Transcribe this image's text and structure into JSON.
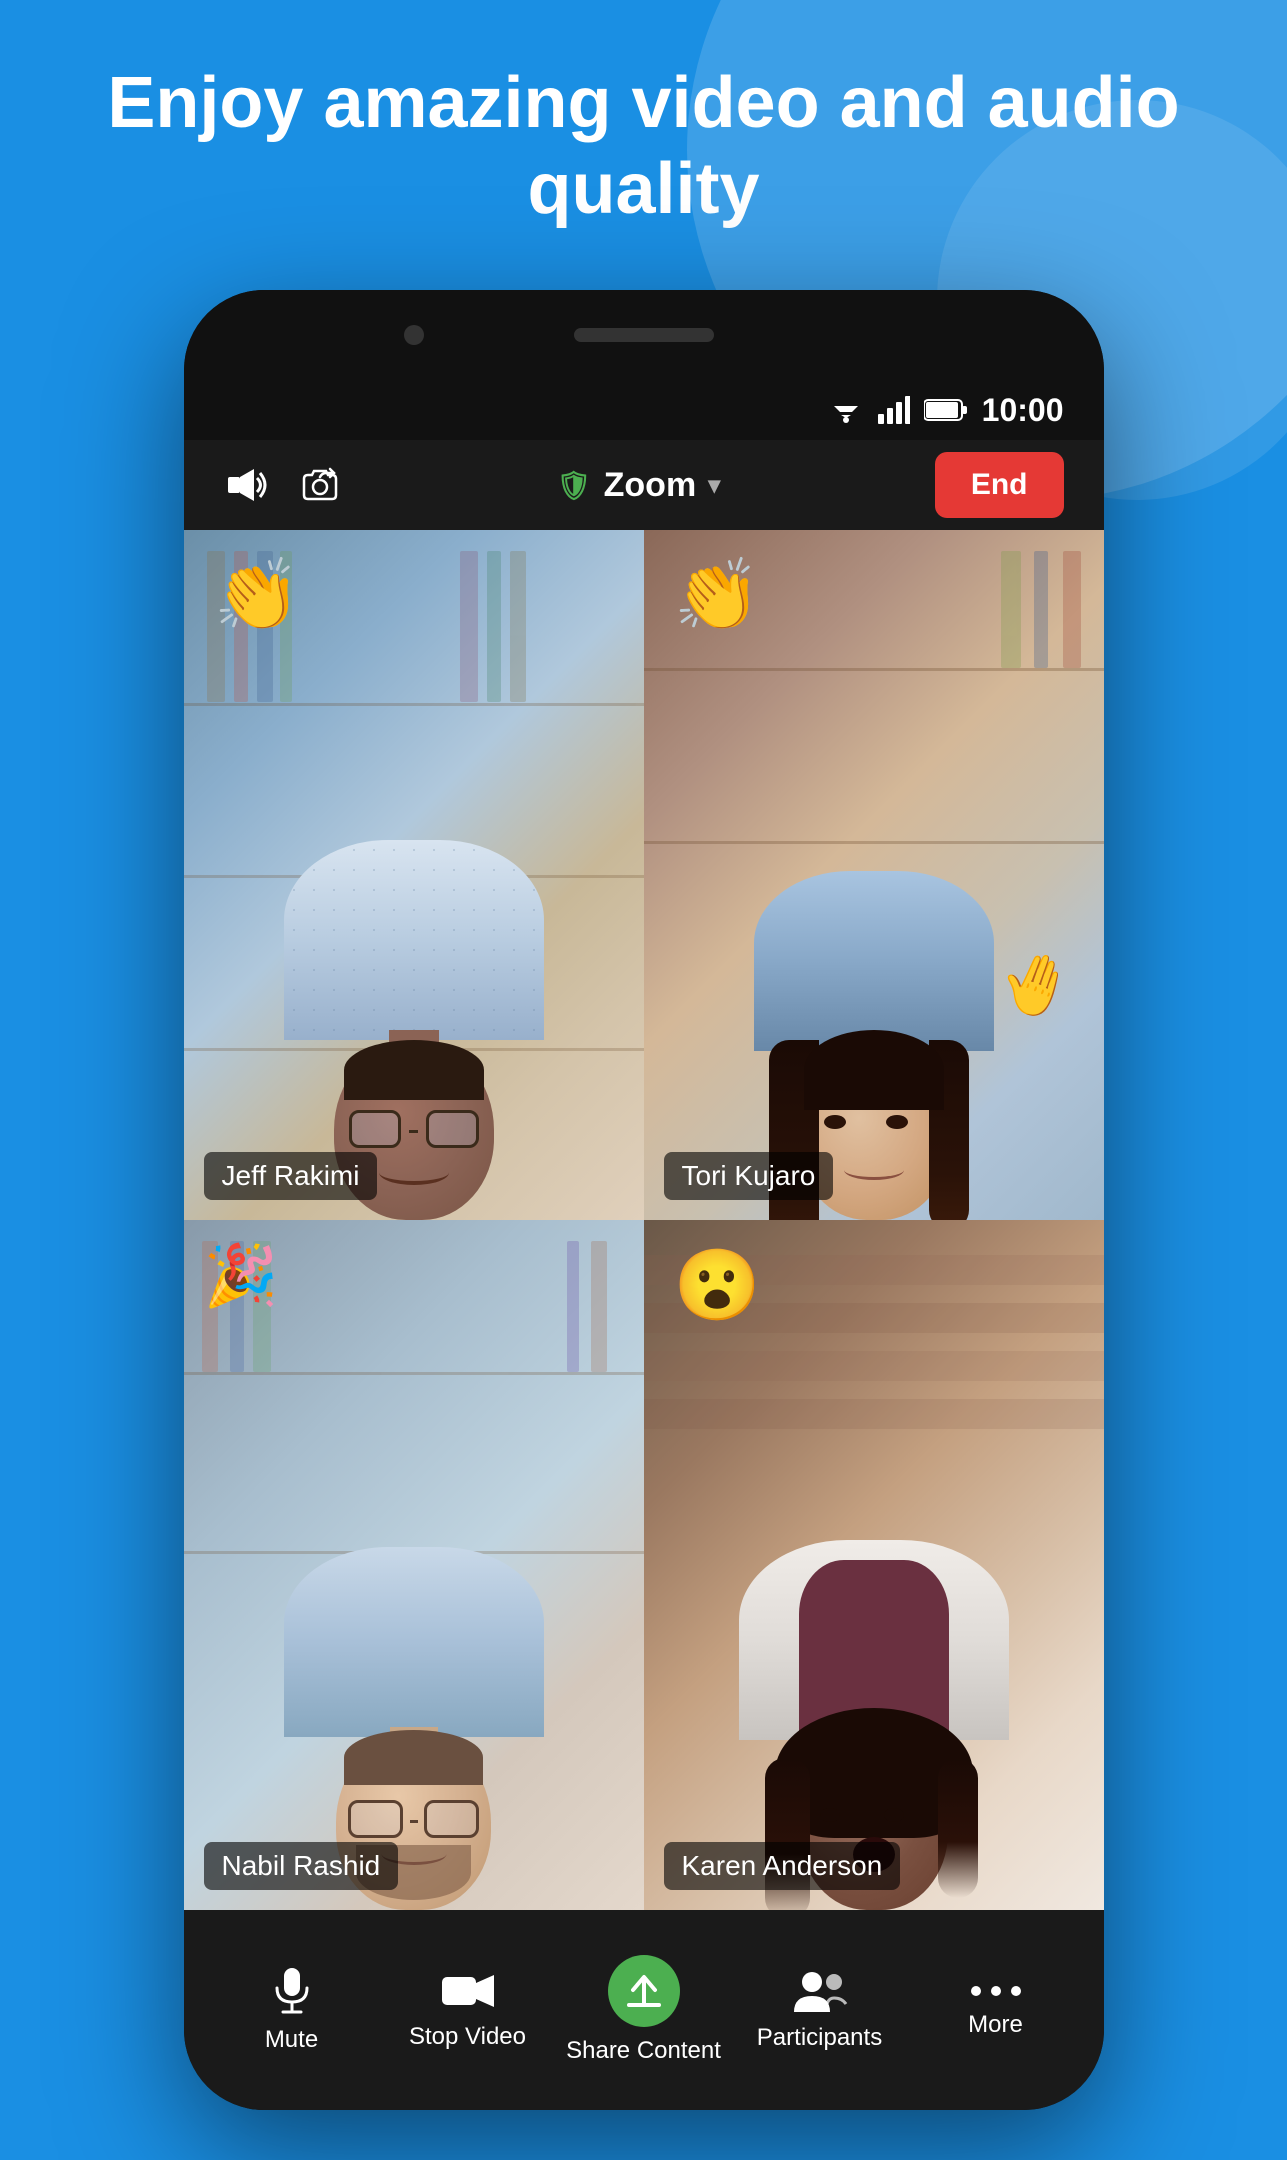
{
  "hero": {
    "title": "Enjoy amazing video\nand audio quality"
  },
  "status_bar": {
    "time": "10:00"
  },
  "zoom_bar": {
    "brand": "Zoom",
    "end_label": "End"
  },
  "participants": [
    {
      "name": "Jeff Rakimi",
      "position": "top-left",
      "emoji": "👏",
      "emoji_position": "top-left",
      "active_speaker": false
    },
    {
      "name": "Tori Kujaro",
      "position": "top-right",
      "emoji": "👏",
      "emoji_position": "top-left",
      "active_speaker": true
    },
    {
      "name": "Nabil Rashid",
      "position": "bottom-left",
      "emoji": "🎉",
      "emoji_position": "top-left",
      "active_speaker": false
    },
    {
      "name": "Karen Anderson",
      "position": "bottom-right",
      "emoji": "😮",
      "emoji_position": "top-left",
      "active_speaker": false
    }
  ],
  "bottom_nav": [
    {
      "id": "mute",
      "icon": "🎤",
      "label": "Mute"
    },
    {
      "id": "stop-video",
      "icon": "📹",
      "label": "Stop Video"
    },
    {
      "id": "share-content",
      "icon": "↑",
      "label": "Share Content"
    },
    {
      "id": "participants",
      "icon": "👥",
      "label": "Participants"
    },
    {
      "id": "more",
      "icon": "···",
      "label": "More"
    }
  ]
}
